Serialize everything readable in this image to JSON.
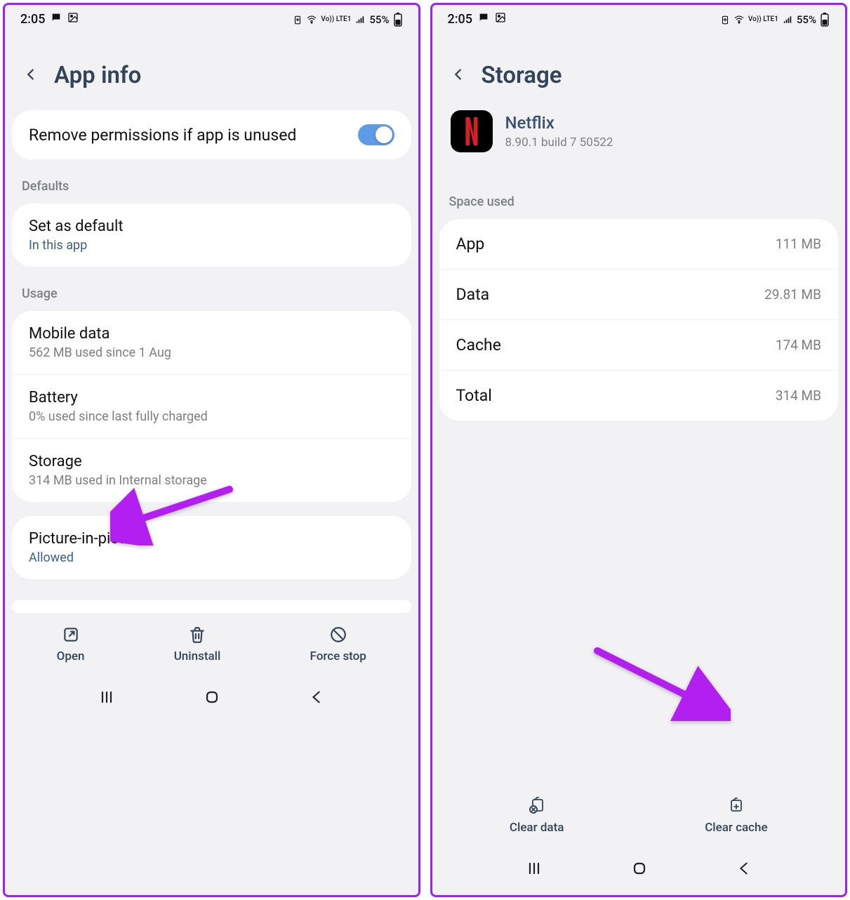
{
  "status": {
    "time": "2:05",
    "battery_pct": "55%",
    "lte_label": "Vo)) LTE1"
  },
  "left": {
    "title": "App info",
    "remove_perms": {
      "label": "Remove permissions if app is unused",
      "toggled": true
    },
    "defaults_label": "Defaults",
    "set_default": {
      "title": "Set as default",
      "sub": "In this app"
    },
    "usage_label": "Usage",
    "mobile_data": {
      "title": "Mobile data",
      "sub": "562 MB used since 1 Aug"
    },
    "battery": {
      "title": "Battery",
      "sub": "0% used since last fully charged"
    },
    "storage": {
      "title": "Storage",
      "sub": "314 MB used in Internal storage"
    },
    "pip": {
      "title": "Picture-in-picture",
      "sub": "Allowed"
    },
    "actions": {
      "open": "Open",
      "uninstall": "Uninstall",
      "force_stop": "Force stop"
    }
  },
  "right": {
    "title": "Storage",
    "app": {
      "name": "Netflix",
      "version": "8.90.1 build 7 50522"
    },
    "space_used_label": "Space used",
    "rows": {
      "app": {
        "label": "App",
        "value": "111 MB"
      },
      "data": {
        "label": "Data",
        "value": "29.81 MB"
      },
      "cache": {
        "label": "Cache",
        "value": "174 MB"
      },
      "total": {
        "label": "Total",
        "value": "314 MB"
      }
    },
    "actions": {
      "clear_data": "Clear data",
      "clear_cache": "Clear cache"
    }
  }
}
